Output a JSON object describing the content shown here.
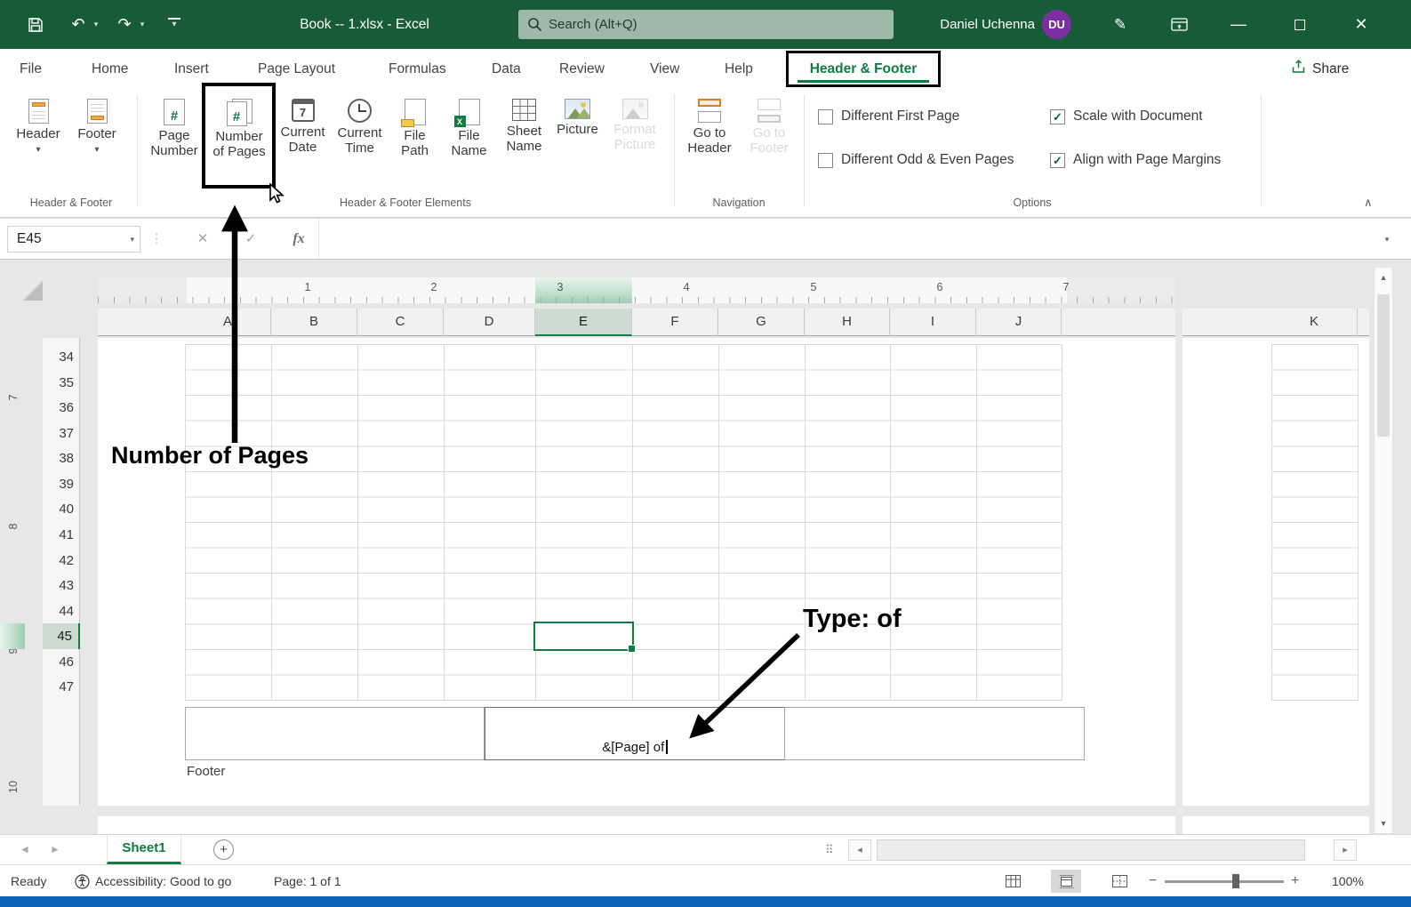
{
  "titlebar": {
    "title": "Book -- 1.xlsx - Excel",
    "search_placeholder": "Search (Alt+Q)",
    "user_name": "Daniel Uchenna",
    "user_initials": "DU"
  },
  "icons": {
    "dropdown": "▾",
    "undo": "↶",
    "redo": "↷",
    "minimize": "—",
    "close": "✕",
    "cancel": "✕",
    "enter": "✓",
    "fx": "fx",
    "pen": "✎",
    "vdots": "⋮",
    "dots": "⠿",
    "collapse": "∧",
    "up": "▲",
    "down": "▼",
    "left": "◂",
    "right": "▸",
    "tab_prev": "◄",
    "tab_next": "►",
    "plus": "+",
    "minus": "−",
    "hash": "#",
    "calendar_digit": "7",
    "excel_x": "X"
  },
  "menu": {
    "items": [
      "File",
      "Home",
      "Insert",
      "Page Layout",
      "Formulas",
      "Data",
      "Review",
      "View",
      "Help"
    ],
    "active": "Header & Footer",
    "share": "Share"
  },
  "ribbon": {
    "header_button": "Header",
    "footer_button": "Footer",
    "elements": [
      {
        "line1": "Page",
        "line2": "Number"
      },
      {
        "line1": "Number",
        "line2": "of Pages"
      },
      {
        "line1": "Current",
        "line2": "Date"
      },
      {
        "line1": "Current",
        "line2": "Time"
      },
      {
        "line1": "File",
        "line2": "Path"
      },
      {
        "line1": "File",
        "line2": "Name"
      },
      {
        "line1": "Sheet",
        "line2": "Name"
      },
      {
        "line1": "Picture",
        "line2": ""
      },
      {
        "line1": "Format",
        "line2": "Picture",
        "disabled": true
      }
    ],
    "navigation": [
      {
        "line1": "Go to",
        "line2": "Header"
      },
      {
        "line1": "Go to",
        "line2": "Footer",
        "disabled": true
      }
    ],
    "options": [
      {
        "label": "Different First Page",
        "checked": false,
        "mark": ""
      },
      {
        "label": "Different Odd & Even Pages",
        "checked": false,
        "mark": ""
      },
      {
        "label": "Scale with Document",
        "checked": true,
        "mark": "✓"
      },
      {
        "label": "Align with Page Margins",
        "checked": true,
        "mark": "✓"
      }
    ],
    "group_labels": [
      "Header & Footer",
      "Header & Footer Elements",
      "Navigation",
      "Options"
    ]
  },
  "formula": {
    "name_box": "E45",
    "fx": "fx",
    "formula_value": ""
  },
  "sheet": {
    "h_ruler": [
      "1",
      "2",
      "3",
      "4",
      "5",
      "6",
      "7"
    ],
    "v_ruler": [
      "7",
      "8",
      "9",
      "10"
    ],
    "columns": [
      "A",
      "B",
      "C",
      "D",
      "E",
      "F",
      "G",
      "H",
      "I",
      "J"
    ],
    "column_next_page": "K",
    "selected_column": "E",
    "rows": [
      "34",
      "35",
      "36",
      "37",
      "38",
      "39",
      "40",
      "41",
      "42",
      "43",
      "44",
      "45",
      "46",
      "47"
    ],
    "selected_row": "45",
    "footer_center_text": "&[Page] of",
    "footer_label": "Footer"
  },
  "annotations": {
    "pointer_label": "Number of Pages",
    "type_label": "Type: of"
  },
  "sheet_tabs": {
    "active": "Sheet1"
  },
  "status": {
    "ready": "Ready",
    "accessibility": "Accessibility: Good to go",
    "page_indicator": "Page: 1 of 1",
    "zoom_level": "100%"
  },
  "colors": {
    "accent_green": "#107C41",
    "titlebar_green": "#185C37",
    "avatar_purple": "#7C2FA0",
    "annotation_black": "#000000",
    "taskbar_blue": "#0D63B5"
  }
}
